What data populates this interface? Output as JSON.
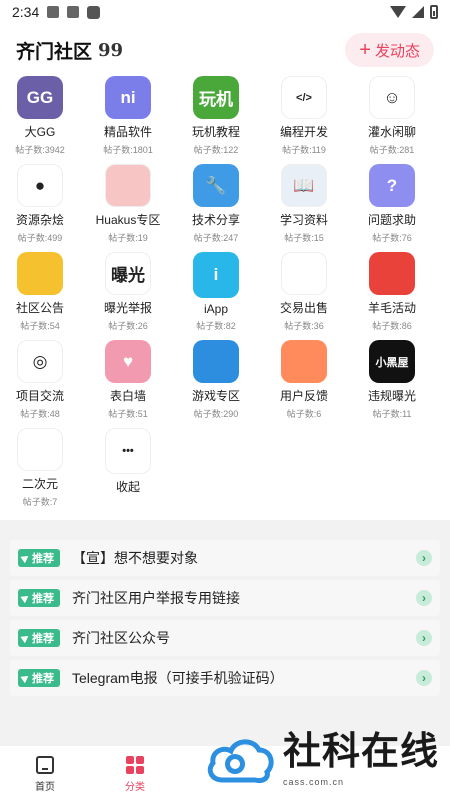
{
  "status_bar": {
    "time": "2:34"
  },
  "header": {
    "title": "齐门社区",
    "quote_icon": "99",
    "post_button": "发动态"
  },
  "grid": [
    {
      "name": "大GG",
      "count": "帖子数:3942",
      "icon": "gg-logo-icon",
      "color": "#6b5fa8",
      "glyph": "GG"
    },
    {
      "name": "精品软件",
      "count": "帖子数:1801",
      "icon": "hexagon-ni-icon",
      "color": "#7b7de8",
      "glyph": "ni"
    },
    {
      "name": "玩机教程",
      "count": "帖子数:122",
      "icon": "android-book-icon",
      "color": "#4aa83a",
      "glyph": "玩机"
    },
    {
      "name": "编程开发",
      "count": "帖子数:119",
      "icon": "code-window-icon",
      "color": "#ffffff",
      "glyph": "</>"
    },
    {
      "name": "灌水闲聊",
      "count": "帖子数:281",
      "icon": "meme-face-icon",
      "color": "#ffffff",
      "glyph": "☺"
    },
    {
      "name": "资源杂烩",
      "count": "帖子数:499",
      "icon": "black-bomb-icon",
      "color": "#ffffff",
      "glyph": "●"
    },
    {
      "name": "Huakus专区",
      "count": "帖子数:19",
      "icon": "huakus-pink-icon",
      "color": "#f7c6c4",
      "glyph": ""
    },
    {
      "name": "技术分享",
      "count": "帖子数:247",
      "icon": "wrench-icon",
      "color": "#3f9be6",
      "glyph": "🔧"
    },
    {
      "name": "学习资料",
      "count": "帖子数:15",
      "icon": "book-icon",
      "color": "#e8eff6",
      "glyph": "📖"
    },
    {
      "name": "问题求助",
      "count": "帖子数:76",
      "icon": "help-screen-icon",
      "color": "#8e8ef0",
      "glyph": "?"
    },
    {
      "name": "社区公告",
      "count": "帖子数:54",
      "icon": "signpost-icon",
      "color": "#f6c12e",
      "glyph": ""
    },
    {
      "name": "曝光举报",
      "count": "帖子数:26",
      "icon": "exposure-icon",
      "color": "#ffffff",
      "glyph": "曝光"
    },
    {
      "name": "iApp",
      "count": "帖子数:82",
      "icon": "iapp-icon",
      "color": "#29b6e8",
      "glyph": "i"
    },
    {
      "name": "交易出售",
      "count": "帖子数:36",
      "icon": "panda-trade-icon",
      "color": "#ffffff",
      "glyph": ""
    },
    {
      "name": "羊毛活动",
      "count": "帖子数:86",
      "icon": "penguin-icon",
      "color": "#e8423a",
      "glyph": ""
    },
    {
      "name": "项目交流",
      "count": "帖子数:48",
      "icon": "target-icon",
      "color": "#ffffff",
      "glyph": "◎"
    },
    {
      "name": "表白墙",
      "count": "帖子数:51",
      "icon": "heart-wall-icon",
      "color": "#f29bb0",
      "glyph": "♥"
    },
    {
      "name": "游戏专区",
      "count": "帖子数:290",
      "icon": "gamepad-icon",
      "color": "#2d8ee0",
      "glyph": ""
    },
    {
      "name": "用户反馈",
      "count": "帖子数:6",
      "icon": "anime-avatar-icon",
      "color": "#ff8a5c",
      "glyph": ""
    },
    {
      "name": "违规曝光",
      "count": "帖子数:11",
      "icon": "dark-room-icon",
      "color": "#111111",
      "glyph": "小黑屋"
    },
    {
      "name": "二次元",
      "count": "帖子数:7",
      "icon": "puppy-icon",
      "color": "#ffffff",
      "glyph": ""
    },
    {
      "name": "收起",
      "count": "",
      "icon": "more-dots-icon",
      "color": "#ffffff",
      "glyph": "•••"
    }
  ],
  "recommend": {
    "badge": "推荐",
    "items": [
      {
        "title": "【宣】想不想要对象"
      },
      {
        "title": "齐门社区用户举报专用链接"
      },
      {
        "title": "齐门社区公众号"
      },
      {
        "title": "Telegram电报（可接手机验证码）"
      }
    ]
  },
  "tabs": [
    {
      "label": "首页",
      "active": false
    },
    {
      "label": "分类",
      "active": true
    }
  ],
  "watermark": {
    "name": "社科在线",
    "url": "cass.com.cn"
  },
  "colors": {
    "accent": "#e8425e",
    "badge": "#3bbb8b"
  }
}
